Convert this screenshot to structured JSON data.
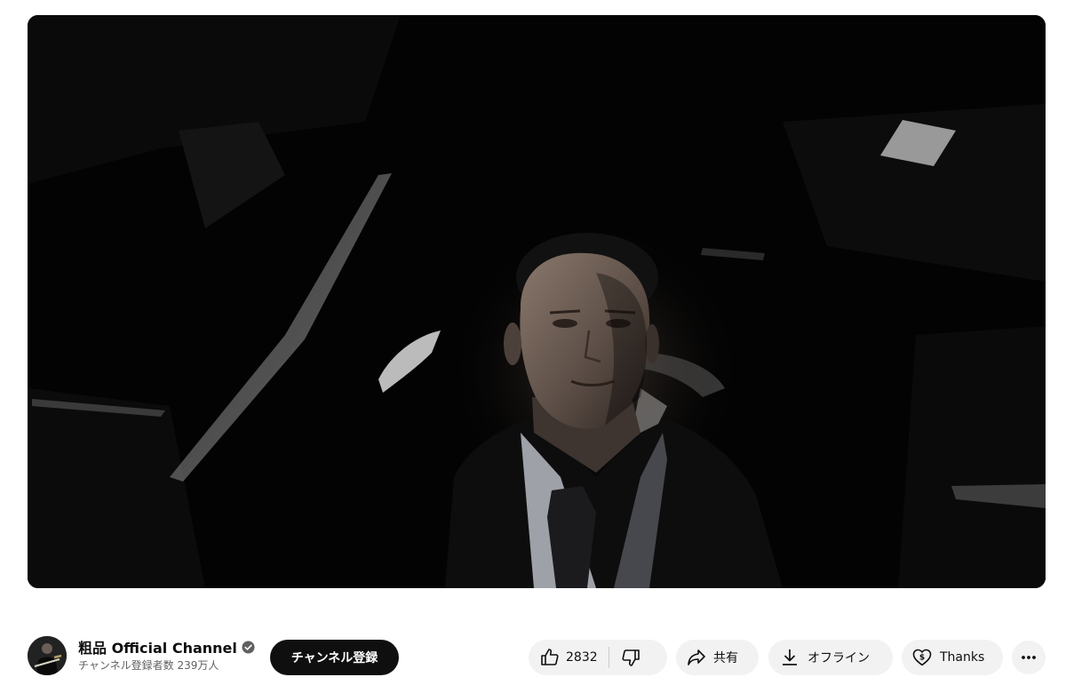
{
  "video": {
    "scene": "dark car interior, man in suit seated"
  },
  "channel": {
    "name": "粗品 Official Channel",
    "subscribers": "チャンネル登録者数 239万人",
    "verified": true
  },
  "actions": {
    "subscribe_label": "チャンネル登録",
    "like_count": "2832",
    "share_label": "共有",
    "offline_label": "オフライン",
    "thanks_label": "Thanks"
  },
  "icons": {
    "avatar": "channel-avatar",
    "verified": "verified-check-icon",
    "like": "thumbs-up-icon",
    "dislike": "thumbs-down-icon",
    "share": "share-arrow-icon",
    "offline": "download-icon",
    "thanks": "heart-dollar-icon",
    "more": "more-horizontal-icon"
  },
  "colors": {
    "subscribe_bg": "#0f0f0f",
    "pill_bg": "#f2f2f2",
    "secondary_text": "#606060"
  }
}
